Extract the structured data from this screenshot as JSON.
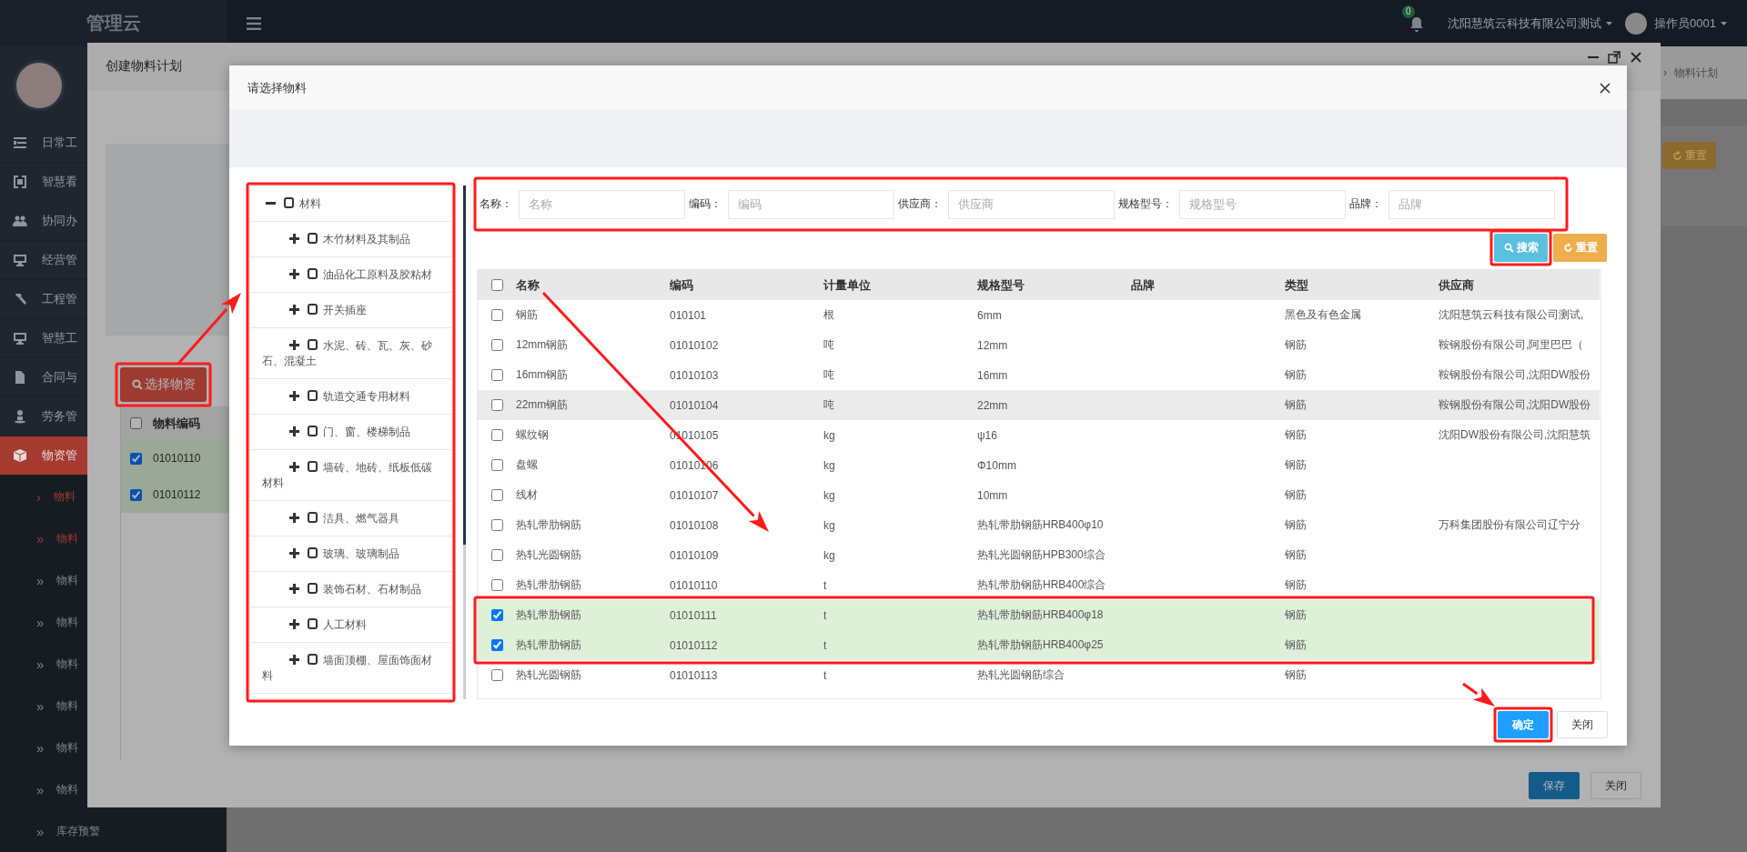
{
  "topbar": {
    "logo": "管理云",
    "notifications": "0",
    "company": "沈阳慧筑云科技有限公司测试",
    "operator": "操作员0001"
  },
  "sidebar": {
    "menu": [
      {
        "label": "日常工",
        "kind": "list",
        "selected": false
      },
      {
        "label": "智慧看",
        "kind": "board",
        "selected": false
      },
      {
        "label": "协同办",
        "kind": "users",
        "selected": false
      },
      {
        "label": "经营管",
        "kind": "monitor",
        "selected": false
      },
      {
        "label": "工程管",
        "kind": "hammer",
        "selected": false
      },
      {
        "label": "智慧工",
        "kind": "monitor",
        "selected": false
      },
      {
        "label": "合同与",
        "kind": "file",
        "selected": false
      },
      {
        "label": "劳务管",
        "kind": "person",
        "selected": false
      },
      {
        "label": "物资管",
        "kind": "cube",
        "selected": true
      }
    ],
    "submenu": [
      {
        "marker": "›",
        "label": "物料",
        "highlighted": true
      },
      {
        "marker": "»",
        "label": "物料",
        "highlighted": true
      },
      {
        "marker": "»",
        "label": "物料",
        "highlighted": false
      },
      {
        "marker": "»",
        "label": "物料",
        "highlighted": false
      },
      {
        "marker": "»",
        "label": "物料",
        "highlighted": false
      },
      {
        "marker": "»",
        "label": "物料",
        "highlighted": false
      },
      {
        "marker": "»",
        "label": "物料",
        "highlighted": false
      },
      {
        "marker": "»",
        "label": "物料",
        "highlighted": false
      },
      {
        "marker": "»",
        "label": "库存预警",
        "highlighted": false
      }
    ]
  },
  "background_page": {
    "breadcrumb_separator": "›",
    "breadcrumb_current": "物料计划",
    "reset_button": "重置"
  },
  "outer_dialog": {
    "title": "创建物料计划",
    "pick_button": "选择物资",
    "table": {
      "header": "物料编码",
      "header_checked": false,
      "rows": [
        {
          "code": "01010110",
          "checked": true
        },
        {
          "code": "01010112",
          "checked": true
        }
      ]
    },
    "buttons": [
      {
        "label": "保存",
        "kind": "primary"
      },
      {
        "label": "关闭",
        "kind": "default"
      }
    ]
  },
  "inner_dialog": {
    "title": "请选择物料",
    "tree": [
      {
        "label": "材料",
        "expanded": true,
        "checked": false,
        "children": [
          {
            "label": "木竹材料及其制品",
            "expanded": false,
            "checked": false
          },
          {
            "label": "油品化工原料及胶粘材",
            "expanded": false,
            "checked": false
          },
          {
            "label": "开关插座",
            "expanded": false,
            "checked": false
          },
          {
            "label": "水泥、砖、瓦、灰、砂石、混凝土",
            "expanded": false,
            "checked": false
          },
          {
            "label": "轨道交通专用材料",
            "expanded": false,
            "checked": false
          },
          {
            "label": "门、窗、楼梯制品",
            "expanded": false,
            "checked": false
          },
          {
            "label": "墙砖、地砖、纸板低碳材料",
            "expanded": false,
            "checked": false
          },
          {
            "label": "洁具、燃气器具",
            "expanded": false,
            "checked": false
          },
          {
            "label": "玻璃、玻璃制品",
            "expanded": false,
            "checked": false
          },
          {
            "label": "装饰石材、石材制品",
            "expanded": false,
            "checked": false
          },
          {
            "label": "人工材料",
            "expanded": false,
            "checked": false
          },
          {
            "label": "墙面顶棚、屋面饰面材料",
            "expanded": false,
            "checked": false
          }
        ]
      }
    ],
    "filters": [
      {
        "label": "名称：",
        "placeholder": "名称"
      },
      {
        "label": "编码：",
        "placeholder": "编码"
      },
      {
        "label": "供应商：",
        "placeholder": "供应商"
      },
      {
        "label": "规格型号：",
        "placeholder": "规格型号"
      },
      {
        "label": "品牌：",
        "placeholder": "品牌"
      }
    ],
    "actions": [
      {
        "label": "搜索",
        "kind": "search"
      },
      {
        "label": "重置",
        "kind": "reset"
      }
    ],
    "table": {
      "header_checked": false,
      "columns": [
        "名称",
        "编码",
        "计量单位",
        "规格型号",
        "品牌",
        "类型",
        "供应商"
      ],
      "rows": [
        {
          "selected": false,
          "hovered": false,
          "name": "钢筋",
          "code": "010101",
          "unit": "根",
          "spec": "6mm",
          "type": "黑色及有色金属",
          "supplier": "沈阳慧筑云科技有限公司测试,"
        },
        {
          "selected": false,
          "hovered": false,
          "name": "12mm钢筋",
          "code": "01010102",
          "unit": "吨",
          "spec": "12mm",
          "type": "钢筋",
          "supplier": "鞍钢股份有限公司,阿里巴巴（"
        },
        {
          "selected": false,
          "hovered": false,
          "name": "16mm钢筋",
          "code": "01010103",
          "unit": "吨",
          "spec": "16mm",
          "type": "钢筋",
          "supplier": "鞍钢股份有限公司,沈阳DW股份"
        },
        {
          "selected": false,
          "hovered": true,
          "name": "22mm钢筋",
          "code": "01010104",
          "unit": "吨",
          "spec": "22mm",
          "type": "钢筋",
          "supplier": "鞍钢股份有限公司,沈阳DW股份"
        },
        {
          "selected": false,
          "hovered": false,
          "name": "螺纹钢",
          "code": "01010105",
          "unit": "kg",
          "spec": "ψ16",
          "type": "钢筋",
          "supplier": "沈阳DW股份有限公司,沈阳慧筑"
        },
        {
          "selected": false,
          "hovered": false,
          "name": "盘螺",
          "code": "01010106",
          "unit": "kg",
          "spec": "Φ10mm",
          "type": "钢筋"
        },
        {
          "selected": false,
          "hovered": false,
          "name": "线材",
          "code": "01010107",
          "unit": "kg",
          "spec": "10mm",
          "type": "钢筋"
        },
        {
          "selected": false,
          "hovered": false,
          "name": "热轧带肋钢筋",
          "code": "01010108",
          "unit": "kg",
          "spec": "热轧带肋钢筋HRB400φ10",
          "type": "钢筋",
          "supplier": "万科集团股份有限公司辽宁分"
        },
        {
          "selected": false,
          "hovered": false,
          "name": "热轧光圆钢筋",
          "code": "01010109",
          "unit": "kg",
          "spec": "热轧光圆钢筋HPB300综合",
          "type": "钢筋"
        },
        {
          "selected": false,
          "hovered": false,
          "name": "热轧带肋钢筋",
          "code": "01010110",
          "unit": "t",
          "spec": "热轧带肋钢筋HRB400综合",
          "type": "钢筋"
        },
        {
          "selected": true,
          "hovered": false,
          "name": "热轧带肋钢筋",
          "code": "01010111",
          "unit": "t",
          "spec": "热轧带肋钢筋HRB400φ18",
          "type": "钢筋"
        },
        {
          "selected": true,
          "hovered": false,
          "name": "热轧带肋钢筋",
          "code": "01010112",
          "unit": "t",
          "spec": "热轧带肋钢筋HRB400φ25",
          "type": "钢筋"
        },
        {
          "selected": false,
          "hovered": false,
          "name": "热轧光圆钢筋",
          "code": "01010113",
          "unit": "t",
          "spec": "热轧光圆钢筋综合",
          "type": "钢筋"
        }
      ]
    },
    "buttons": [
      {
        "label": "确定",
        "kind": "primary"
      },
      {
        "label": "关闭",
        "kind": "default"
      }
    ]
  }
}
